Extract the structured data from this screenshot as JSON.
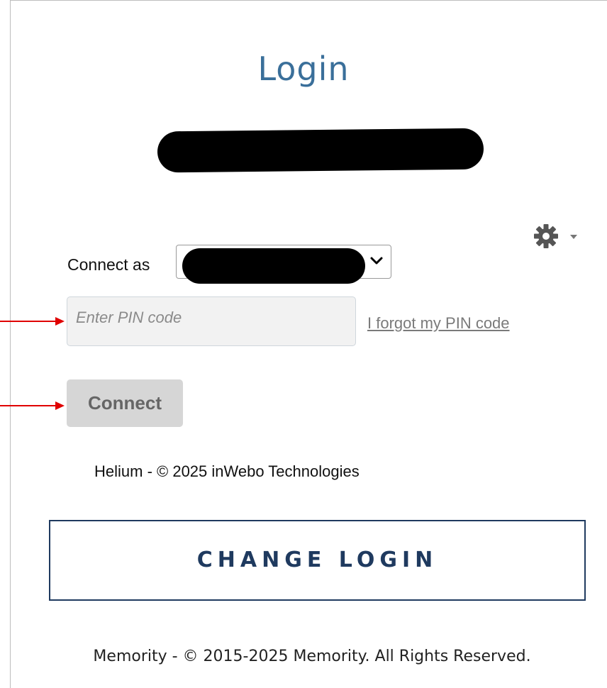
{
  "login": {
    "title": "Login",
    "connect_as_label": "Connect as",
    "pin_placeholder": "Enter PIN code",
    "pin_value": "",
    "forgot_pin_link": "I forgot my PIN code",
    "connect_button": "Connect",
    "helium_footer": "Helium - © 2025 inWebo Technologies"
  },
  "actions": {
    "change_login": "CHANGE LOGIN"
  },
  "footer": {
    "copyright": "Memority - © 2015-2025 Memority. All Rights Reserved."
  },
  "icons": {
    "settings": "gear-icon",
    "dropdown": "chevron-down-icon",
    "annotation": "arrow-right-icon"
  },
  "colors": {
    "title": "#3a6f9a",
    "change_login": "#1f3a5f",
    "connect_button_bg": "#d6d6d6",
    "annotation_arrow": "#e00000",
    "redaction": "#000000"
  }
}
